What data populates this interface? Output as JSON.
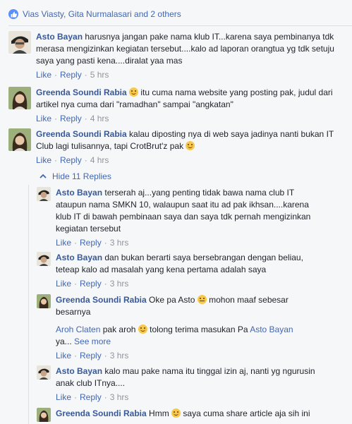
{
  "reactions": {
    "summary": "Vias Viasty, Gita Nurmalasari and 2 others",
    "icon": "thumbs-up-icon"
  },
  "actions": {
    "like": "Like",
    "reply": "Reply",
    "separator": "·"
  },
  "comments": [
    {
      "author": "Asto Bayan",
      "text": "harusnya jangan pake nama klub IT...karena saya pembinanya tdk merasa mengizinkan kegiatan tersebut....kalo ad laporan orangtua yg tdk setuju saya yang pasti kena....diralat yaa mas",
      "time": "5 hrs"
    },
    {
      "author": "Greenda Soundi Rabia",
      "emoji": "tongue-wink-emoji",
      "text": "itu cuma nama website yang posting pak, judul dari artikel nya cuma dari \"ramadhan\" sampai \"angkatan\"",
      "time": "4 hrs"
    },
    {
      "author": "Greenda Soundi Rabia",
      "text": "kalau diposting nya di web saya jadinya nanti bukan IT Club lagi tulisannya, tapi CrotBrut'z pak",
      "emoji": "smile-emoji",
      "time": "4 hrs"
    }
  ],
  "hide_replies": "Hide 11 Replies",
  "replies": [
    {
      "author": "Asto Bayan",
      "text": "terserah aj...yang penting tidak bawa nama club IT ataupun nama SMKN 10, walaupun saat itu ad pak ikhsan....karena klub IT di bawah pembinaan saya dan saya tdk pernah mengizinkan kegiatan tersebut",
      "time": "3 hrs"
    },
    {
      "author": "Asto Bayan",
      "text": "dan bukan berarti saya bersebrangan dengan beliau, teteap kalo ad masalah yang kena pertama adalah saya",
      "time": "3 hrs"
    },
    {
      "author": "Greenda Soundi Rabia",
      "text_before": "Oke pa Asto",
      "emoji": "neutral-face-emoji",
      "text_after": "mohon maaf sebesar besarnya",
      "mention_name": "Aroh Claten",
      "mention_text": "pak aroh",
      "mention_text2": "tolong terima masukan Pa",
      "mention_name2": "Asto Bayan",
      "mention_tail": "ya...",
      "see_more": "See more",
      "time": "3 hrs"
    },
    {
      "author": "Asto Bayan",
      "text": "kalo mau pake nama itu tinggal izin aj, nanti yg ngurusin anak club ITnya....",
      "time": "3 hrs"
    },
    {
      "author": "Greenda Soundi Rabia",
      "text_before": "Hmm",
      "text_after": "saya cuma share article aja sih ini"
    }
  ],
  "colors": {
    "link": "#4267b2",
    "name": "#385898",
    "muted": "#90949c",
    "background": "#f6f7f9"
  }
}
